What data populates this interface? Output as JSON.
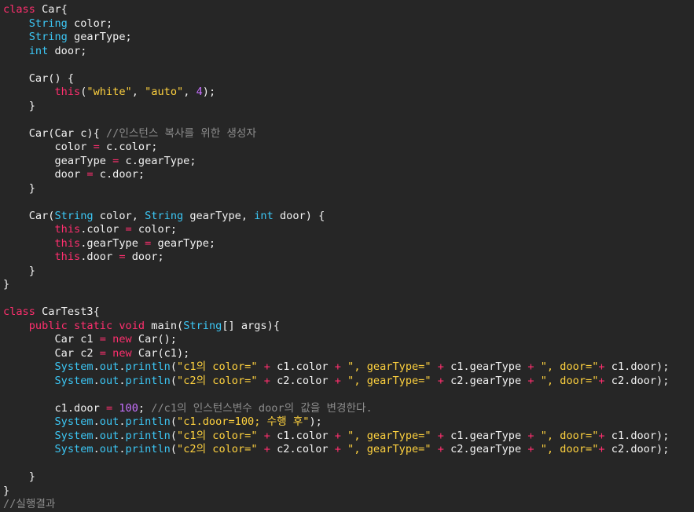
{
  "editor": {
    "background": "#262626",
    "colors": {
      "keyword": "#ff2f6e",
      "type": "#3cc7f5",
      "plain": "#f2f2f2",
      "string": "#ffd23f",
      "number": "#c770ff",
      "operator": "#ff2f6e",
      "comment": "#8c8c8c"
    },
    "lines": [
      [
        [
          "keyword",
          "class"
        ],
        [
          "plain",
          " Car{"
        ]
      ],
      [
        [
          "plain",
          "    "
        ],
        [
          "type",
          "String"
        ],
        [
          "plain",
          " color;"
        ]
      ],
      [
        [
          "plain",
          "    "
        ],
        [
          "type",
          "String"
        ],
        [
          "plain",
          " gearType;"
        ]
      ],
      [
        [
          "plain",
          "    "
        ],
        [
          "type",
          "int"
        ],
        [
          "plain",
          " door;"
        ]
      ],
      [],
      [
        [
          "plain",
          "    Car() {"
        ]
      ],
      [
        [
          "plain",
          "        "
        ],
        [
          "keyword",
          "this"
        ],
        [
          "plain",
          "("
        ],
        [
          "string",
          "\"white\""
        ],
        [
          "plain",
          ", "
        ],
        [
          "string",
          "\"auto\""
        ],
        [
          "plain",
          ", "
        ],
        [
          "number",
          "4"
        ],
        [
          "plain",
          ");"
        ]
      ],
      [
        [
          "plain",
          "    }"
        ]
      ],
      [],
      [
        [
          "plain",
          "    Car(Car c){ "
        ],
        [
          "comment",
          "//인스턴스 복사를 위한 생성자"
        ]
      ],
      [
        [
          "plain",
          "        color "
        ],
        [
          "op",
          "="
        ],
        [
          "plain",
          " c.color;"
        ]
      ],
      [
        [
          "plain",
          "        gearType "
        ],
        [
          "op",
          "="
        ],
        [
          "plain",
          " c.gearType;"
        ]
      ],
      [
        [
          "plain",
          "        door "
        ],
        [
          "op",
          "="
        ],
        [
          "plain",
          " c.door;"
        ]
      ],
      [
        [
          "plain",
          "    }"
        ]
      ],
      [],
      [
        [
          "plain",
          "    Car("
        ],
        [
          "type",
          "String"
        ],
        [
          "plain",
          " color, "
        ],
        [
          "type",
          "String"
        ],
        [
          "plain",
          " gearType, "
        ],
        [
          "type",
          "int"
        ],
        [
          "plain",
          " door) {"
        ]
      ],
      [
        [
          "plain",
          "        "
        ],
        [
          "keyword",
          "this"
        ],
        [
          "plain",
          ".color "
        ],
        [
          "op",
          "="
        ],
        [
          "plain",
          " color;"
        ]
      ],
      [
        [
          "plain",
          "        "
        ],
        [
          "keyword",
          "this"
        ],
        [
          "plain",
          ".gearType "
        ],
        [
          "op",
          "="
        ],
        [
          "plain",
          " gearType;"
        ]
      ],
      [
        [
          "plain",
          "        "
        ],
        [
          "keyword",
          "this"
        ],
        [
          "plain",
          ".door "
        ],
        [
          "op",
          "="
        ],
        [
          "plain",
          " door;"
        ]
      ],
      [
        [
          "plain",
          "    }"
        ]
      ],
      [
        [
          "plain",
          "}"
        ]
      ],
      [],
      [
        [
          "keyword",
          "class"
        ],
        [
          "plain",
          " CarTest3{"
        ]
      ],
      [
        [
          "plain",
          "    "
        ],
        [
          "keyword",
          "public"
        ],
        [
          "plain",
          " "
        ],
        [
          "keyword",
          "static"
        ],
        [
          "plain",
          " "
        ],
        [
          "keyword",
          "void"
        ],
        [
          "plain",
          " main("
        ],
        [
          "type",
          "String"
        ],
        [
          "plain",
          "[] args){"
        ]
      ],
      [
        [
          "plain",
          "        Car c1 "
        ],
        [
          "op",
          "="
        ],
        [
          "plain",
          " "
        ],
        [
          "keyword",
          "new"
        ],
        [
          "plain",
          " Car();"
        ]
      ],
      [
        [
          "plain",
          "        Car c2 "
        ],
        [
          "op",
          "="
        ],
        [
          "plain",
          " "
        ],
        [
          "keyword",
          "new"
        ],
        [
          "plain",
          " Car(c1);"
        ]
      ],
      [
        [
          "plain",
          "        "
        ],
        [
          "type",
          "System"
        ],
        [
          "plain",
          "."
        ],
        [
          "type",
          "out"
        ],
        [
          "plain",
          "."
        ],
        [
          "type",
          "println"
        ],
        [
          "plain",
          "("
        ],
        [
          "string",
          "\"c1의 color=\""
        ],
        [
          "plain",
          " "
        ],
        [
          "op",
          "+"
        ],
        [
          "plain",
          " c1.color "
        ],
        [
          "op",
          "+"
        ],
        [
          "plain",
          " "
        ],
        [
          "string",
          "\", gearType=\""
        ],
        [
          "plain",
          " "
        ],
        [
          "op",
          "+"
        ],
        [
          "plain",
          " c1.gearType "
        ],
        [
          "op",
          "+"
        ],
        [
          "plain",
          " "
        ],
        [
          "string",
          "\", door=\""
        ],
        [
          "op",
          "+"
        ],
        [
          "plain",
          " c1.door);"
        ]
      ],
      [
        [
          "plain",
          "        "
        ],
        [
          "type",
          "System"
        ],
        [
          "plain",
          "."
        ],
        [
          "type",
          "out"
        ],
        [
          "plain",
          "."
        ],
        [
          "type",
          "println"
        ],
        [
          "plain",
          "("
        ],
        [
          "string",
          "\"c2의 color=\""
        ],
        [
          "plain",
          " "
        ],
        [
          "op",
          "+"
        ],
        [
          "plain",
          " c2.color "
        ],
        [
          "op",
          "+"
        ],
        [
          "plain",
          " "
        ],
        [
          "string",
          "\", gearType=\""
        ],
        [
          "plain",
          " "
        ],
        [
          "op",
          "+"
        ],
        [
          "plain",
          " c2.gearType "
        ],
        [
          "op",
          "+"
        ],
        [
          "plain",
          " "
        ],
        [
          "string",
          "\", door=\""
        ],
        [
          "op",
          "+"
        ],
        [
          "plain",
          " c2.door);"
        ]
      ],
      [],
      [
        [
          "plain",
          "        c1.door "
        ],
        [
          "op",
          "="
        ],
        [
          "plain",
          " "
        ],
        [
          "number",
          "100"
        ],
        [
          "plain",
          "; "
        ],
        [
          "comment",
          "//c1의 인스턴스변수 door의 값을 변경한다."
        ]
      ],
      [
        [
          "plain",
          "        "
        ],
        [
          "type",
          "System"
        ],
        [
          "plain",
          "."
        ],
        [
          "type",
          "out"
        ],
        [
          "plain",
          "."
        ],
        [
          "type",
          "println"
        ],
        [
          "plain",
          "("
        ],
        [
          "string",
          "\"c1.door=100; 수행 후\""
        ],
        [
          "plain",
          ");"
        ]
      ],
      [
        [
          "plain",
          "        "
        ],
        [
          "type",
          "System"
        ],
        [
          "plain",
          "."
        ],
        [
          "type",
          "out"
        ],
        [
          "plain",
          "."
        ],
        [
          "type",
          "println"
        ],
        [
          "plain",
          "("
        ],
        [
          "string",
          "\"c1의 color=\""
        ],
        [
          "plain",
          " "
        ],
        [
          "op",
          "+"
        ],
        [
          "plain",
          " c1.color "
        ],
        [
          "op",
          "+"
        ],
        [
          "plain",
          " "
        ],
        [
          "string",
          "\", gearType=\""
        ],
        [
          "plain",
          " "
        ],
        [
          "op",
          "+"
        ],
        [
          "plain",
          " c1.gearType "
        ],
        [
          "op",
          "+"
        ],
        [
          "plain",
          " "
        ],
        [
          "string",
          "\", door=\""
        ],
        [
          "op",
          "+"
        ],
        [
          "plain",
          " c1.door);"
        ]
      ],
      [
        [
          "plain",
          "        "
        ],
        [
          "type",
          "System"
        ],
        [
          "plain",
          "."
        ],
        [
          "type",
          "out"
        ],
        [
          "plain",
          "."
        ],
        [
          "type",
          "println"
        ],
        [
          "plain",
          "("
        ],
        [
          "string",
          "\"c2의 color=\""
        ],
        [
          "plain",
          " "
        ],
        [
          "op",
          "+"
        ],
        [
          "plain",
          " c2.color "
        ],
        [
          "op",
          "+"
        ],
        [
          "plain",
          " "
        ],
        [
          "string",
          "\", gearType=\""
        ],
        [
          "plain",
          " "
        ],
        [
          "op",
          "+"
        ],
        [
          "plain",
          " c2.gearType "
        ],
        [
          "op",
          "+"
        ],
        [
          "plain",
          " "
        ],
        [
          "string",
          "\", door=\""
        ],
        [
          "op",
          "+"
        ],
        [
          "plain",
          " c2.door);"
        ]
      ],
      [],
      [
        [
          "plain",
          "    }"
        ]
      ],
      [
        [
          "plain",
          "}"
        ]
      ],
      [
        [
          "comment",
          "//실행결과"
        ]
      ]
    ]
  }
}
